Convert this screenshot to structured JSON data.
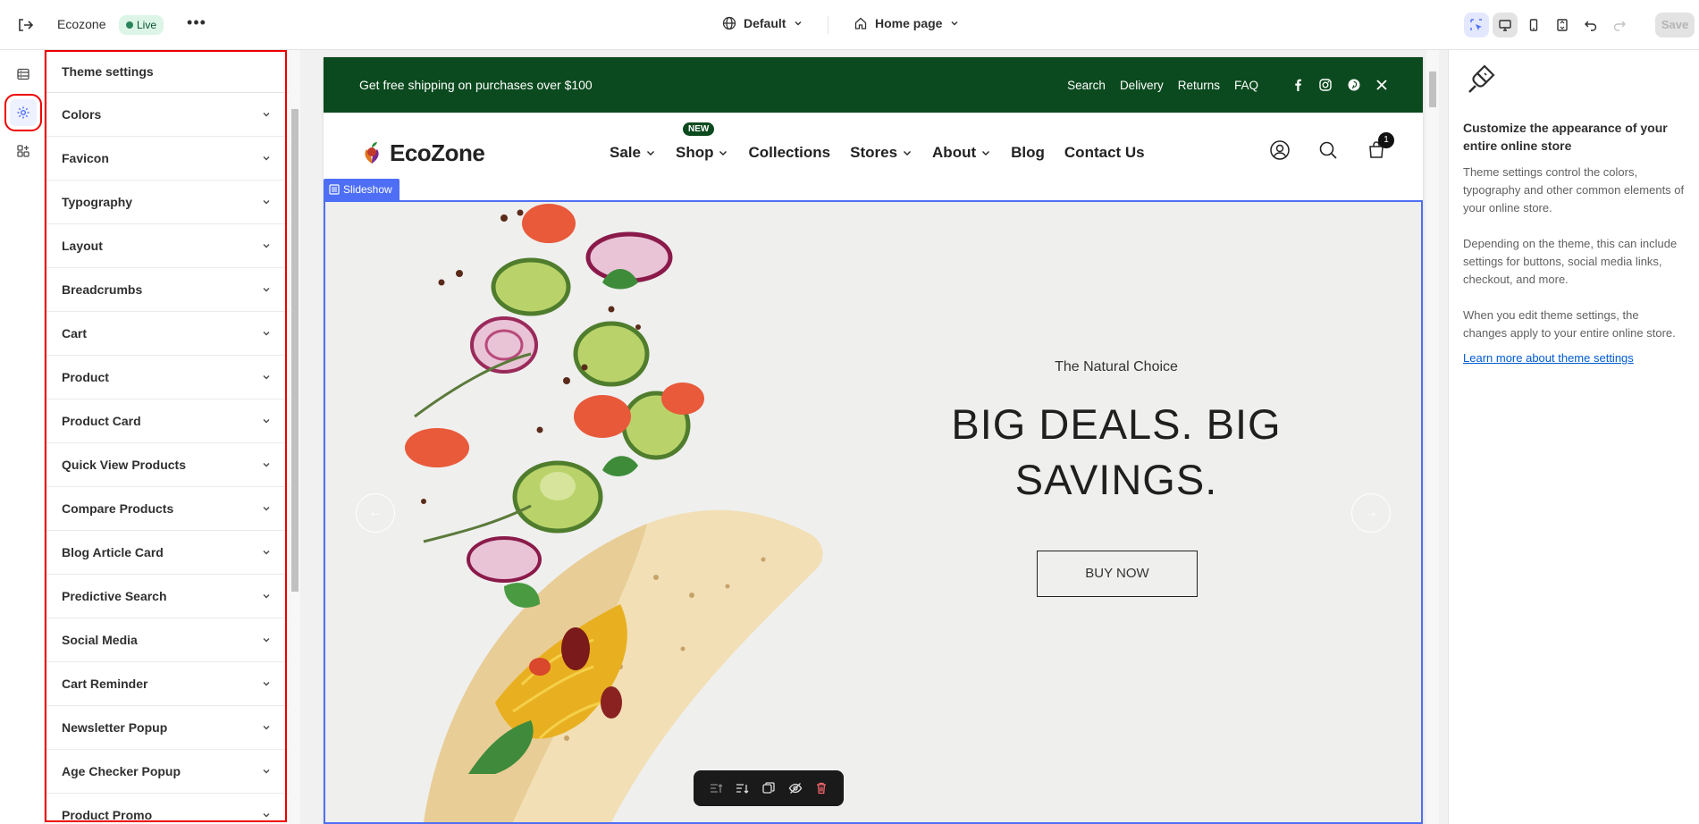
{
  "topbar": {
    "store_name": "Ecozone",
    "status": "Live",
    "theme": "Default",
    "page": "Home page",
    "save_label": "Save"
  },
  "rail": {
    "items": [
      "sections-icon",
      "theme-settings-icon",
      "apps-icon"
    ],
    "active": "theme-settings-icon"
  },
  "settings": {
    "title": "Theme settings",
    "items": [
      "Colors",
      "Favicon",
      "Typography",
      "Layout",
      "Breadcrumbs",
      "Cart",
      "Product",
      "Product Card",
      "Quick View Products",
      "Compare Products",
      "Blog Article Card",
      "Predictive Search",
      "Social Media",
      "Cart Reminder",
      "Newsletter Popup",
      "Age Checker Popup",
      "Product Promo"
    ]
  },
  "store": {
    "announcement": "Get free shipping on purchases over $100",
    "top_links": [
      "Search",
      "Delivery",
      "Returns",
      "FAQ"
    ],
    "social": [
      "facebook-icon",
      "instagram-icon",
      "pinterest-icon",
      "x-icon"
    ],
    "logo": "EcoZone",
    "nav": [
      {
        "label": "Sale",
        "dropdown": true
      },
      {
        "label": "Shop",
        "dropdown": true,
        "badge": "NEW"
      },
      {
        "label": "Collections",
        "dropdown": false
      },
      {
        "label": "Stores",
        "dropdown": true
      },
      {
        "label": "About",
        "dropdown": true
      },
      {
        "label": "Blog",
        "dropdown": false
      },
      {
        "label": "Contact Us",
        "dropdown": false
      }
    ],
    "cart_count": "1",
    "section_tag": "Slideshow",
    "hero": {
      "subtitle": "The Natural Choice",
      "title": "BIG DEALS. BIG SAVINGS.",
      "button": "BUY NOW"
    }
  },
  "info": {
    "title": "Customize the appearance of your entire online store",
    "paragraphs": [
      "Theme settings control the colors, typography and other common elements of your online store.",
      "Depending on the theme, this can include settings for buttons, social media links, checkout, and more.",
      "When you edit theme settings, the changes apply to your entire online store."
    ],
    "link": "Learn more about theme settings"
  },
  "colors": {
    "brand_green": "#0b4a1e",
    "selection_blue": "#4e6ff5",
    "highlight_red": "#ee0000",
    "link_blue": "#005bd3"
  }
}
